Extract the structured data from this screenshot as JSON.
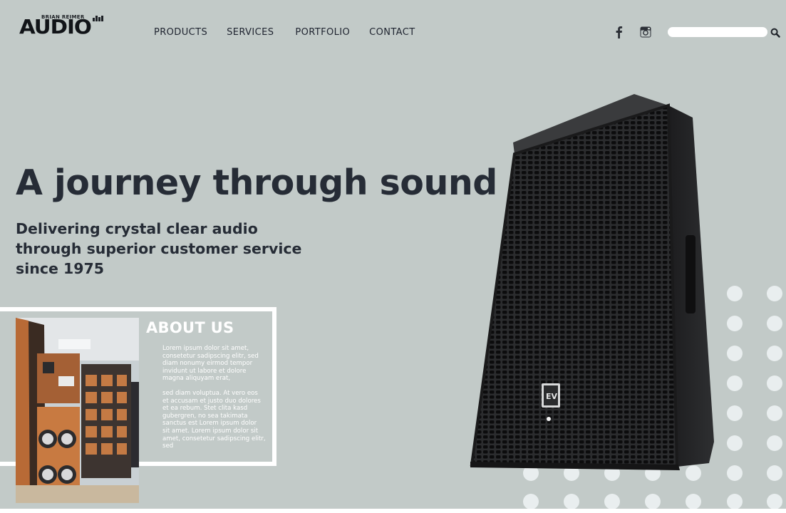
{
  "header": {
    "logo_small": "BRIAN REIMER",
    "logo_main": "AUDIO",
    "nav": {
      "products": "PRODUCTS",
      "services": "SERVICES",
      "portfolio": "PORTFOLIO",
      "contact": "CONTACT"
    },
    "search": {
      "value": "",
      "placeholder": ""
    }
  },
  "hero": {
    "title": "A journey through sound",
    "subtitle": "Delivering crystal clear audio through superior customer service since 1975"
  },
  "about": {
    "heading": "ABOUT US",
    "paragraph1": "Lorem ipsum dolor sit amet, consetetur sadipscing elitr, sed diam nonumy eirmod tempor invidunt ut labore et dolore magna aliquyam erat,",
    "paragraph2": "sed diam voluptua. At vero eos et accusam et justo duo dolores et ea rebum. Stet clita kasd gubergren, no sea takimata sanctus est Lorem ipsum dolor sit amet. Lorem ipsum dolor sit amet, consetetur sadipscing elitr, sed"
  },
  "colors": {
    "background": "#c2cac8",
    "text": "#262c36",
    "accent": "#ffffff",
    "dots": "#e9eeef"
  },
  "icons": [
    "facebook-icon",
    "instagram-icon",
    "search-icon"
  ]
}
